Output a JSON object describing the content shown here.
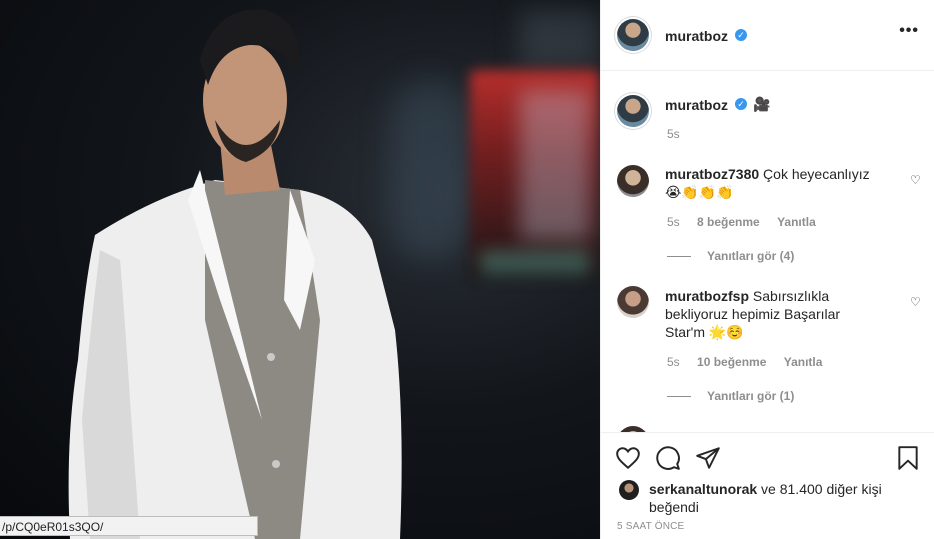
{
  "post": {
    "status_url": "/p/CQ0eR01s3QO/"
  },
  "header": {
    "username": "muratboz",
    "more_label": "•••"
  },
  "caption": {
    "username": "muratboz",
    "emoji": "🎥",
    "time": "5s"
  },
  "comments": [
    {
      "username": "muratboz7380",
      "text_line1": "Çok heyecanlıyız",
      "text_line2": "😭👏👏👏",
      "time": "5s",
      "likes": "8 beğenme",
      "reply": "Yanıtla",
      "view_replies": "Yanıtları gör (4)"
    },
    {
      "username": "muratbozfsp",
      "text_line1": "Sabırsızlıkla",
      "text_line2": "bekliyoruz hepimiz Başarılar",
      "text_line3": "Star'm 🌟☺️",
      "time": "5s",
      "likes": "10 beğenme",
      "reply": "Yanıtla",
      "view_replies": "Yanıtları gör (1)"
    }
  ],
  "likes": {
    "username": "serkanaltunorak",
    "rest_line1": " ve 81.400 diğer kişi",
    "line2": "beğendi"
  },
  "timestamp": "5 SAAT ÖNCE",
  "icons": [
    "heart-icon",
    "comment-icon",
    "share-icon",
    "bookmark-icon",
    "verified-icon",
    "more-icon"
  ],
  "colors": {
    "verified": "#3897f0",
    "text": "#262626",
    "muted": "#8e8e8e"
  }
}
